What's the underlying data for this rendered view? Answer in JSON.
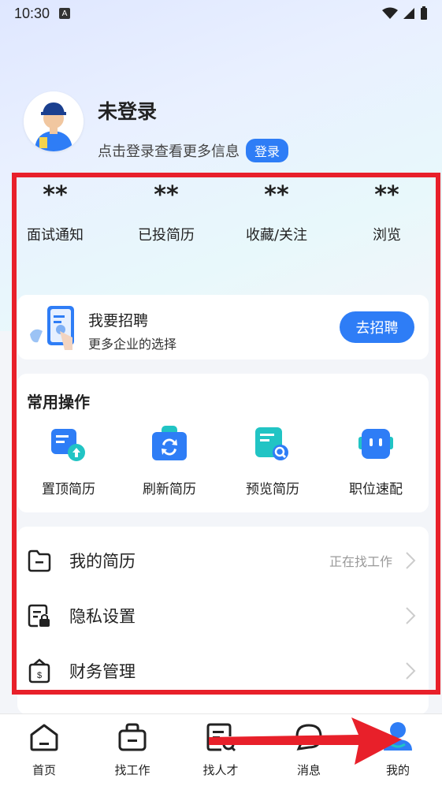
{
  "status_bar": {
    "time": "10:30",
    "badge": "A"
  },
  "profile": {
    "name": "未登录",
    "subtitle": "点击登录查看更多信息",
    "login_label": "登录"
  },
  "stats": [
    {
      "value": "**",
      "label": "面试通知"
    },
    {
      "value": "**",
      "label": "已投简历"
    },
    {
      "value": "**",
      "label": "收藏/关注"
    },
    {
      "value": "**",
      "label": "浏览"
    }
  ],
  "recruit": {
    "title": "我要招聘",
    "subtitle": "更多企业的选择",
    "button": "去招聘"
  },
  "ops": {
    "title": "常用操作",
    "items": [
      {
        "label": "置顶简历",
        "icon": "resume-top-icon"
      },
      {
        "label": "刷新简历",
        "icon": "refresh-resume-icon"
      },
      {
        "label": "预览简历",
        "icon": "preview-resume-icon"
      },
      {
        "label": "职位速配",
        "icon": "job-match-icon"
      }
    ]
  },
  "menu": [
    {
      "label": "我的简历",
      "status": "正在找工作",
      "icon": "folder-icon"
    },
    {
      "label": "隐私设置",
      "status": "",
      "icon": "privacy-lock-icon"
    },
    {
      "label": "财务管理",
      "status": "",
      "icon": "wallet-icon"
    }
  ],
  "tabs": [
    {
      "label": "首页",
      "icon": "home-icon"
    },
    {
      "label": "找工作",
      "icon": "briefcase-icon"
    },
    {
      "label": "找人才",
      "icon": "talent-search-icon"
    },
    {
      "label": "消息",
      "icon": "message-icon"
    },
    {
      "label": "我的",
      "icon": "person-icon",
      "active": true
    }
  ],
  "colors": {
    "accent": "#2e7df6",
    "highlight": "#e8202a"
  }
}
